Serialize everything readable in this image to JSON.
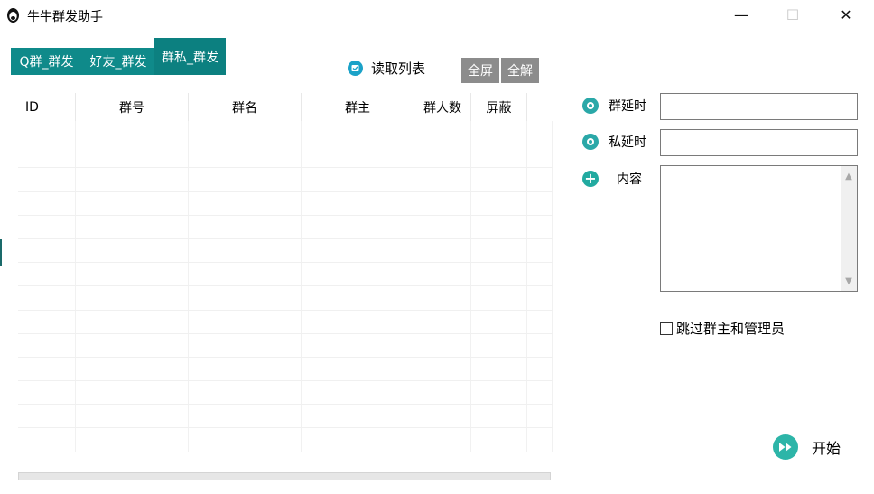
{
  "window": {
    "title": "牛牛群发助手",
    "controls": {
      "minimize": "—",
      "maximize": "☐",
      "close": "✕"
    }
  },
  "tabs": [
    {
      "label": "Q群_群发"
    },
    {
      "label": "好友_群发"
    },
    {
      "label": "群私_群发",
      "selected": true
    }
  ],
  "toolbar": {
    "read_list_label": "读取列表",
    "fullscreen_label": "全屏",
    "unlock_label": "全解"
  },
  "table": {
    "columns": [
      "ID",
      "群号",
      "群名",
      "群主",
      "群人数",
      "屏蔽"
    ],
    "rows": []
  },
  "settings": {
    "group_delay_label": "群延时",
    "group_delay_value": "",
    "private_delay_label": "私延时",
    "private_delay_value": "",
    "content_label": "内容",
    "content_value": "",
    "skip_label": "跳过群主和管理员",
    "skip_checked": false,
    "start_label": "开始"
  },
  "colors": {
    "tab_bg": "#0f8a8a",
    "accent_teal": "#2aa8a8",
    "read_icon": "#1ba2c8",
    "gray_button": "#8c8c8c"
  },
  "icons": {
    "app": "app-logo-icon",
    "read": "checkbox-envelope-icon",
    "delay": "radio-circle-icon",
    "content": "plus-circle-icon",
    "start": "fast-forward-icon"
  }
}
